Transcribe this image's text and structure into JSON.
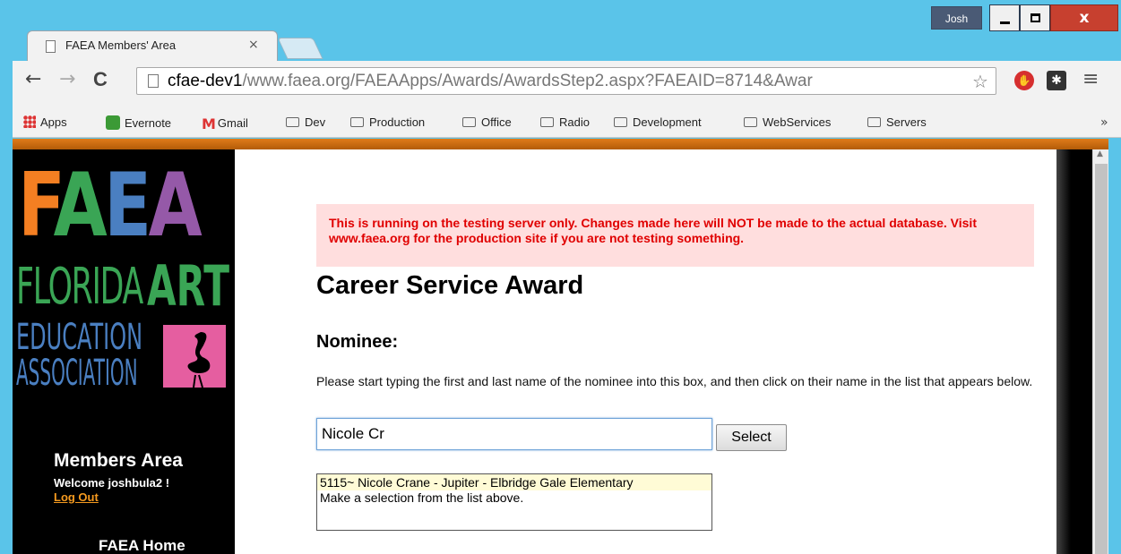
{
  "window": {
    "user": "Josh",
    "close_glyph": "x"
  },
  "tab": {
    "title": "FAEA Members' Area",
    "close_glyph": "×"
  },
  "toolbar": {
    "back": "←",
    "forward": "→",
    "reload": "C",
    "url_host": "cfae-dev1",
    "url_path": "/www.faea.org/FAEAApps/Awards/AwardsStep2.aspx?FAEAID=8714&Awar",
    "star_glyph": "☆",
    "menu_glyph": "≡"
  },
  "bookmarks": {
    "items": [
      "Apps",
      "Evernote",
      "Gmail",
      "Dev",
      "Production",
      "Office",
      "Radio",
      "Development",
      "WebServices",
      "Servers"
    ],
    "more": "»"
  },
  "sidebar": {
    "logo_letters": [
      "F",
      "A",
      "E",
      "A"
    ],
    "logo_florida": "FLORIDA",
    "logo_art": "ART",
    "logo_education": "EDUCATION",
    "logo_association": "ASSOCIATION",
    "members_title": "Members Area",
    "welcome_prefix": "Welcome ",
    "username": "joshbula2",
    "welcome_suffix": " !",
    "logout": "Log Out",
    "home": "FAEA Home"
  },
  "main": {
    "warning": "This is running on the testing server only. Changes made here will NOT be made to the actual database. Visit www.faea.org for the production site if you are not testing something.",
    "title": "Career Service Award",
    "nominee_label": "Nominee:",
    "instructions": "Please start typing the first and last name of the nominee into this box, and then click on their name in the list that appears below.",
    "nominee_value": "Nicole Cr",
    "select_label": "Select",
    "suggestion": "5115~ Nicole Crane - Jupiter - Elbridge Gale Elementary",
    "suggestion_hint": "Make a selection from the list above."
  },
  "colors": {
    "warning_bg": "#ffdede",
    "warning_text": "#e00000",
    "accent_orange": "#e07b1a",
    "logo_orange": "#f47f22",
    "logo_green": "#3aa555",
    "logo_blue": "#4a7fc1",
    "logo_purple": "#9559a8",
    "flamingo_pink": "#e55ea0"
  }
}
